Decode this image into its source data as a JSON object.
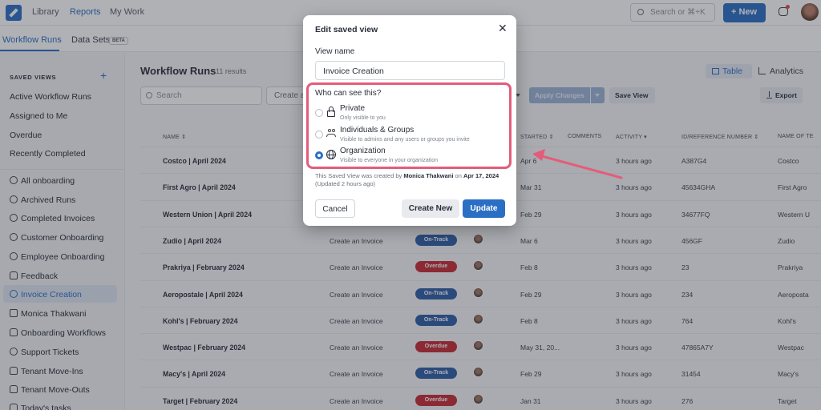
{
  "topbar": {
    "nav": [
      "Library",
      "Reports",
      "My Work"
    ],
    "search_placeholder": "Search or ⌘+K",
    "new_button": "+ New"
  },
  "subtabs": {
    "items": [
      "Workflow Runs",
      "Data Sets"
    ],
    "beta": "BETA"
  },
  "sidebar": {
    "title": "SAVED VIEWS",
    "plus": "+",
    "plain_items": [
      "Active Workflow Runs",
      "Assigned to Me",
      "Overdue",
      "Recently Completed"
    ],
    "icon_items": [
      {
        "label": "All onboarding",
        "icon": "globe-icon"
      },
      {
        "label": "Archived Runs",
        "icon": "globe-icon"
      },
      {
        "label": "Completed Invoices",
        "icon": "globe-icon"
      },
      {
        "label": "Customer Onboarding",
        "icon": "globe-icon"
      },
      {
        "label": "Employee Onboarding",
        "icon": "globe-icon"
      },
      {
        "label": "Feedback",
        "icon": "group-icon"
      },
      {
        "label": "Invoice Creation",
        "icon": "globe-icon",
        "active": true
      },
      {
        "label": "Monica Thakwani",
        "icon": "lock-icon"
      },
      {
        "label": "Onboarding Workflows",
        "icon": "group-icon"
      },
      {
        "label": "Support Tickets",
        "icon": "globe-icon"
      },
      {
        "label": "Tenant Move-Ins",
        "icon": "group-icon"
      },
      {
        "label": "Tenant Move-Outs",
        "icon": "group-icon"
      },
      {
        "label": "Today's tasks",
        "icon": "group-icon"
      }
    ]
  },
  "main": {
    "title": "Workflow Runs",
    "count": "11 results",
    "search_placeholder": "Search",
    "filter_stub": "Create a",
    "view_table": "Table",
    "view_analytics": "Analytics",
    "apply_changes": "Apply Changes",
    "save_view": "Save View",
    "export": "Export"
  },
  "table": {
    "headers": [
      "NAME ⇕",
      "STARTED ⇕",
      "COMMENTS",
      "ACTIVITY ▾",
      "ID/REFERENCE NUMBER ⇕",
      "NAME OF TE"
    ],
    "rows": [
      {
        "name": "Costco | April 2024",
        "task": "",
        "status": "",
        "started": "Apr 6",
        "activity": "3 hours ago",
        "id": "A387G4",
        "ref": "Costco"
      },
      {
        "name": "First Agro | April 2024",
        "task": "",
        "status": "",
        "started": "Mar 31",
        "activity": "3 hours ago",
        "id": "45634GHA",
        "ref": "First Agro"
      },
      {
        "name": "Western Union | April 2024",
        "task": "",
        "status": "",
        "started": "Feb 29",
        "activity": "3 hours ago",
        "id": "34677FQ",
        "ref": "Western U"
      },
      {
        "name": "Zudio | April 2024",
        "task": "Create an Invoice",
        "status": "On-Track",
        "started": "Mar 6",
        "activity": "3 hours ago",
        "id": "456GF",
        "ref": "Zudio"
      },
      {
        "name": "Prakriya | February 2024",
        "task": "Create an Invoice",
        "status": "Overdue",
        "started": "Feb 8",
        "activity": "3 hours ago",
        "id": "23",
        "ref": "Prakriya"
      },
      {
        "name": "Aeropostale | April 2024",
        "task": "Create an Invoice",
        "status": "On-Track",
        "started": "Feb 29",
        "activity": "3 hours ago",
        "id": "234",
        "ref": "Aeroposta"
      },
      {
        "name": "Kohl's | February 2024",
        "task": "Create an Invoice",
        "status": "On-Track",
        "started": "Feb 8",
        "activity": "3 hours ago",
        "id": "764",
        "ref": "Kohl's"
      },
      {
        "name": "Westpac | February 2024",
        "task": "Create an Invoice",
        "status": "Overdue",
        "started": "May 31, 20...",
        "activity": "3 hours ago",
        "id": "47865A7Y",
        "ref": "Westpac"
      },
      {
        "name": "Macy's | April 2024",
        "task": "Create an Invoice",
        "status": "On-Track",
        "started": "Feb 29",
        "activity": "3 hours ago",
        "id": "31454",
        "ref": "Macy's"
      },
      {
        "name": "Target | February 2024",
        "task": "Create an Invoice",
        "status": "Overdue",
        "started": "Jan 31",
        "activity": "3 hours ago",
        "id": "276",
        "ref": "Target"
      }
    ]
  },
  "modal": {
    "title": "Edit saved view",
    "close": "✕",
    "field_label": "View name",
    "field_value": "Invoice Creation",
    "visibility_label": "Who can see this?",
    "options": [
      {
        "title": "Private",
        "subtitle": "Only visible to you",
        "icon": "lock-icon",
        "checked": false
      },
      {
        "title": "Individuals & Groups",
        "subtitle": "Visible to admins and any users or groups you invite",
        "icon": "group-icon",
        "checked": false
      },
      {
        "title": "Organization",
        "subtitle": "Visible to everyone in your organization",
        "icon": "globe-icon",
        "checked": true
      }
    ],
    "meta_prefix": "This Saved View was created by",
    "meta_author": "Monica Thakwani",
    "meta_on": "on",
    "meta_date": "Apr 17, 2024",
    "meta_updated": "(Updated 2 hours ago)",
    "cancel": "Cancel",
    "create_new": "Create New",
    "update": "Update"
  },
  "colors": {
    "accent": "#2b6fc4",
    "highlight": "#e35d7a",
    "on_track": "#2f5fa6",
    "overdue": "#c62d36"
  }
}
